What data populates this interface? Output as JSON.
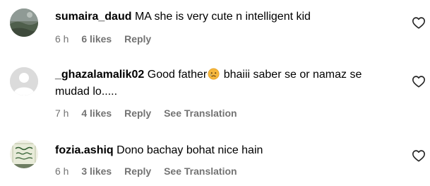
{
  "comments": [
    {
      "username": "sumaira_daud",
      "text": "MA she is very cute n intelligent kid",
      "text_after_emoji": "",
      "time": "6 h",
      "likes": "6 likes",
      "reply": "Reply",
      "translation": "",
      "avatar_icon": "landscape-photo",
      "has_emoji": false
    },
    {
      "username": "_ghazalamalik02",
      "text": "Good father",
      "emoji_icon": "crying-face-emoji",
      "text_after_emoji": "bhaiii saber se or namaz se mudad lo.....",
      "time": "7 h",
      "likes": "4 likes",
      "reply": "Reply",
      "translation": "See Translation",
      "avatar_icon": "default-user-icon",
      "has_emoji": true
    },
    {
      "username": "fozia.ashiq",
      "text": "Dono bachay bohat nice hain",
      "text_after_emoji": "",
      "time": "6 h",
      "likes": "3 likes",
      "reply": "Reply",
      "translation": "See Translation",
      "avatar_icon": "calligraphy-photo",
      "has_emoji": false
    }
  ],
  "colors": {
    "meta_text": "#737373",
    "default_avatar_bg": "#dbdbdb"
  }
}
